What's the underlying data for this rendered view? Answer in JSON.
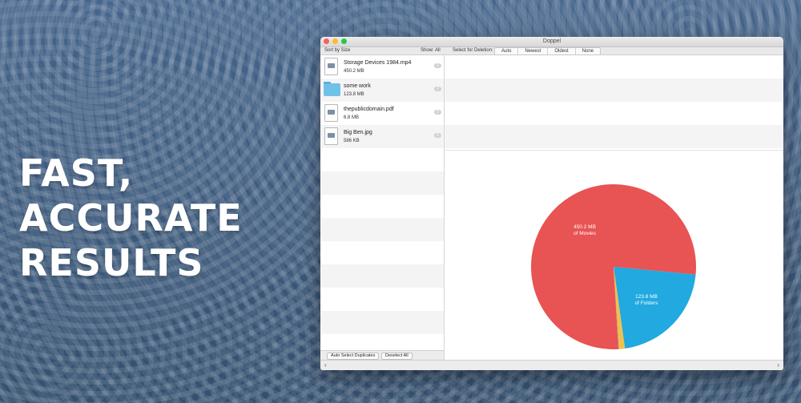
{
  "headline": {
    "line1": "FAST,",
    "line2": "ACCURATE",
    "line3": "RESULTS"
  },
  "window": {
    "title": "Doppel"
  },
  "toolbar": {
    "sort_label": "Sort by Size",
    "show_label": "Show: All",
    "select_label": "Select for Deletion:",
    "options": [
      "Auto",
      "Newest",
      "Oldest",
      "None"
    ]
  },
  "files": [
    {
      "name": "Storage Devices 1984.mp4",
      "size": "450.2 MB",
      "count": "2",
      "icon": "video-file-icon"
    },
    {
      "name": "some work",
      "size": "123.8 MB",
      "count": "2",
      "icon": "folder-icon"
    },
    {
      "name": "thepublicdomain.pdf",
      "size": "6.8 MB",
      "count": "2",
      "icon": "pdf-file-icon"
    },
    {
      "name": "Big Ben.jpg",
      "size": "586 KB",
      "count": "2",
      "icon": "image-file-icon"
    }
  ],
  "buttons": {
    "auto_select": "Auto Select Duplicates",
    "deselect": "Deselect All"
  },
  "chart_data": {
    "type": "pie",
    "slices": [
      {
        "label": "450.2 MB of Movies",
        "line1": "450.2 MB",
        "line2": "of Movies",
        "value": 450.2,
        "color": "#e85353"
      },
      {
        "label": "123.8 MB of Folders",
        "line1": "123.8 MB",
        "line2": "of Folders",
        "value": 123.8,
        "color": "#21a9e0"
      },
      {
        "label": "",
        "value": 6.8,
        "color": "#f2c04a"
      },
      {
        "label": "",
        "value": 0.586,
        "color": "#8e8e8e"
      }
    ]
  },
  "colors": {
    "background": "#3c5a7f",
    "movies": "#e85353",
    "folders": "#21a9e0",
    "documents": "#f2c04a"
  }
}
